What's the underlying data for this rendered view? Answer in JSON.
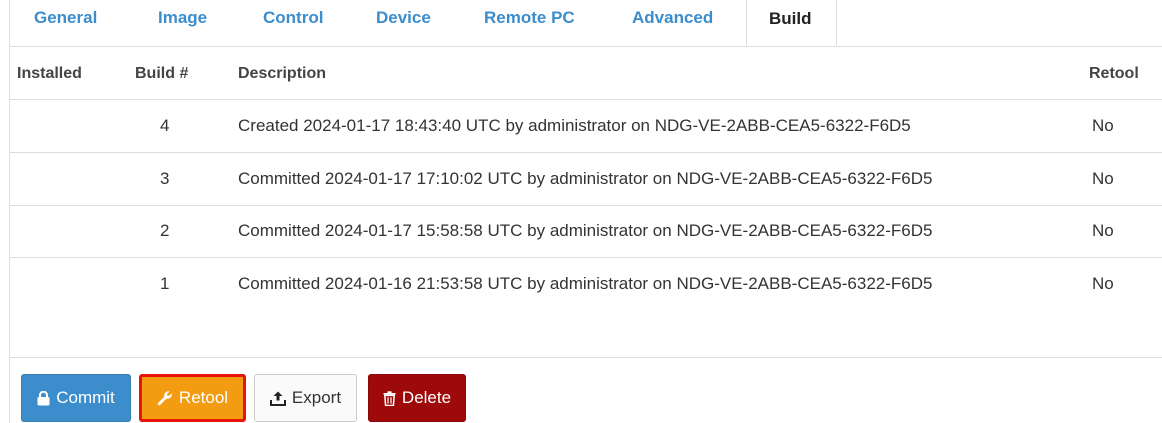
{
  "tabs": [
    {
      "label": "General",
      "active": false
    },
    {
      "label": "Image",
      "active": false
    },
    {
      "label": "Control",
      "active": false
    },
    {
      "label": "Device",
      "active": false
    },
    {
      "label": "Remote PC",
      "active": false
    },
    {
      "label": "Advanced",
      "active": false
    },
    {
      "label": "Build",
      "active": true
    }
  ],
  "table": {
    "columns": [
      "Installed",
      "Build #",
      "Description",
      "Retool"
    ],
    "rows": [
      {
        "installed": "",
        "build": "4",
        "description": "Created 2024-01-17 18:43:40 UTC by administrator on NDG-VE-2ABB-CEA5-6322-F6D5",
        "retool": "No"
      },
      {
        "installed": "",
        "build": "3",
        "description": "Committed 2024-01-17 17:10:02 UTC by administrator on NDG-VE-2ABB-CEA5-6322-F6D5",
        "retool": "No"
      },
      {
        "installed": "",
        "build": "2",
        "description": "Committed 2024-01-17 15:58:58 UTC by administrator on NDG-VE-2ABB-CEA5-6322-F6D5",
        "retool": "No"
      },
      {
        "installed": "",
        "build": "1",
        "description": "Committed 2024-01-16 21:53:58 UTC by administrator on NDG-VE-2ABB-CEA5-6322-F6D5",
        "retool": "No"
      }
    ]
  },
  "actions": {
    "commit_label": "Commit",
    "retool_label": "Retool",
    "export_label": "Export",
    "delete_label": "Delete"
  },
  "icons": {
    "commit": "lock-icon",
    "retool": "wrench-icon",
    "export": "upload-icon",
    "delete": "trash-icon"
  },
  "colors": {
    "tab_link": "#3c8dcb",
    "commit": "#3c8dcb",
    "retool": "#f39c12",
    "retool_highlight": "#e8140c",
    "delete": "#9e0a0a"
  }
}
